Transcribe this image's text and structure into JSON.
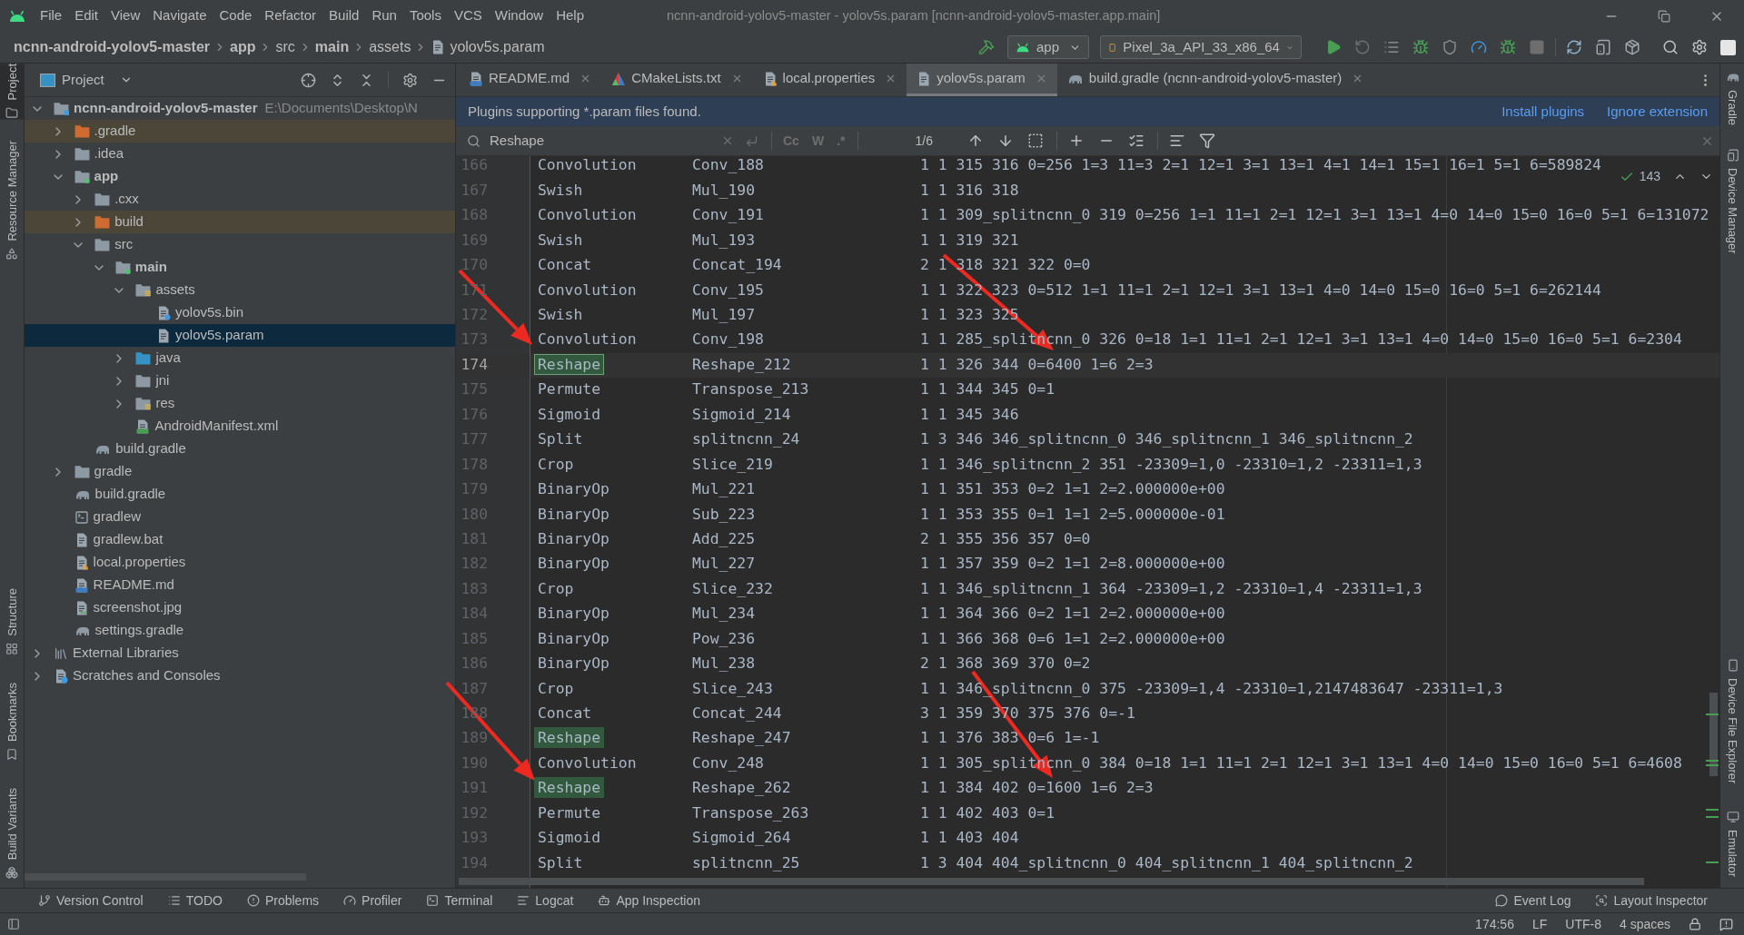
{
  "window": {
    "title": "ncnn-android-yolov5-master - yolov5s.param [ncnn-android-yolov5-master.app.main]"
  },
  "menu": [
    "File",
    "Edit",
    "View",
    "Navigate",
    "Code",
    "Refactor",
    "Build",
    "Run",
    "Tools",
    "VCS",
    "Window",
    "Help"
  ],
  "breadcrumbs": [
    {
      "label": "ncnn-android-yolov5-master",
      "kind": "module"
    },
    {
      "label": "app",
      "kind": "module"
    },
    {
      "label": "src",
      "kind": "folder"
    },
    {
      "label": "main",
      "kind": "module"
    },
    {
      "label": "assets",
      "kind": "folder"
    },
    {
      "label": "yolov5s.param",
      "kind": "file"
    }
  ],
  "toolbar": {
    "run_config": "app",
    "device": "Pixel_3a_API_33_x86_64"
  },
  "left_strip": {
    "top": [
      {
        "label": "Project",
        "kind": "project",
        "selected": true
      },
      {
        "label": "Resource Manager",
        "kind": "resources",
        "selected": false
      }
    ],
    "bottom": [
      {
        "label": "Structure",
        "kind": "structure",
        "selected": false
      },
      {
        "label": "Bookmarks",
        "kind": "bookmarks",
        "selected": false
      },
      {
        "label": "Build Variants",
        "kind": "variants",
        "selected": false
      }
    ]
  },
  "project": {
    "title": "Project",
    "tree": [
      {
        "label": "ncnn-android-yolov5-master",
        "path": "E:\\Documents\\Desktop\\N",
        "kind": "project",
        "expanded": true,
        "selected": false,
        "excluded": false,
        "children": [
          {
            "label": ".gradle",
            "kind": "folder",
            "expanded": false,
            "selected": false,
            "excluded": true
          },
          {
            "label": ".idea",
            "kind": "folder",
            "expanded": false,
            "selected": false,
            "excluded": false
          },
          {
            "label": "app",
            "kind": "module",
            "expanded": true,
            "selected": false,
            "excluded": false,
            "children": [
              {
                "label": ".cxx",
                "kind": "folder",
                "expanded": false,
                "selected": false,
                "excluded": false
              },
              {
                "label": "build",
                "kind": "folder",
                "expanded": false,
                "selected": false,
                "excluded": true
              },
              {
                "label": "src",
                "kind": "folder",
                "expanded": true,
                "selected": false,
                "excluded": false,
                "children": [
                  {
                    "label": "main",
                    "kind": "module",
                    "expanded": true,
                    "selected": false,
                    "excluded": false,
                    "children": [
                      {
                        "label": "assets",
                        "kind": "resources",
                        "expanded": true,
                        "selected": false,
                        "excluded": false,
                        "children": [
                          {
                            "label": "yolov5s.bin",
                            "kind": "binary",
                            "selected": false,
                            "excluded": false
                          },
                          {
                            "label": "yolov5s.param",
                            "kind": "text",
                            "selected": true,
                            "excluded": false
                          }
                        ]
                      },
                      {
                        "label": "java",
                        "kind": "source",
                        "expanded": false,
                        "selected": false,
                        "excluded": false
                      },
                      {
                        "label": "jni",
                        "kind": "folder",
                        "expanded": false,
                        "selected": false,
                        "excluded": false
                      },
                      {
                        "label": "res",
                        "kind": "resources",
                        "expanded": false,
                        "selected": false,
                        "excluded": false
                      },
                      {
                        "label": "AndroidManifest.xml",
                        "kind": "manifest",
                        "selected": false,
                        "excluded": false
                      }
                    ]
                  }
                ]
              },
              {
                "label": "build.gradle",
                "kind": "gradle",
                "selected": false,
                "excluded": false
              }
            ]
          },
          {
            "label": "gradle",
            "kind": "folder",
            "expanded": false,
            "selected": false,
            "excluded": false
          },
          {
            "label": "build.gradle",
            "kind": "gradle",
            "selected": false,
            "excluded": false
          },
          {
            "label": "gradlew",
            "kind": "script",
            "selected": false,
            "excluded": false
          },
          {
            "label": "gradlew.bat",
            "kind": "text",
            "selected": false,
            "excluded": false
          },
          {
            "label": "local.properties",
            "kind": "properties",
            "selected": false,
            "excluded": false
          },
          {
            "label": "README.md",
            "kind": "markdown",
            "selected": false,
            "excluded": false
          },
          {
            "label": "screenshot.jpg",
            "kind": "image",
            "selected": false,
            "excluded": false
          },
          {
            "label": "settings.gradle",
            "kind": "gradle",
            "selected": false,
            "excluded": false
          }
        ]
      },
      {
        "label": "External Libraries",
        "kind": "libraries",
        "expanded": false,
        "selected": false,
        "excluded": false
      },
      {
        "label": "Scratches and Consoles",
        "kind": "scratches",
        "expanded": false,
        "selected": false,
        "excluded": false
      }
    ]
  },
  "tabs": [
    {
      "label": "README.md",
      "kind": "markdown",
      "selected": false
    },
    {
      "label": "CMakeLists.txt",
      "kind": "cmake",
      "selected": false
    },
    {
      "label": "local.properties",
      "kind": "properties",
      "selected": false
    },
    {
      "label": "yolov5s.param",
      "kind": "text",
      "selected": true
    },
    {
      "label": "build.gradle (ncnn-android-yolov5-master)",
      "kind": "gradle",
      "selected": false
    }
  ],
  "notification": {
    "text": "Plugins supporting *.param files found.",
    "actions": [
      "Install plugins",
      "Ignore extension"
    ]
  },
  "search": {
    "value": "Reshape",
    "options": [
      "Cc",
      "W",
      ".*"
    ],
    "count": "1/6"
  },
  "inspection": {
    "count": "143"
  },
  "lines": [
    {
      "number": "166",
      "type": "Convolution",
      "name": "Conv_188",
      "params": "1 1 315 316 0=256 1=3 11=3 2=1 12=1 3=1 13=1 4=1 14=1 15=1 16=1 5=1 6=589824",
      "match": false,
      "current": false
    },
    {
      "number": "167",
      "type": "Swish",
      "name": "Mul_190",
      "params": "1 1 316 318",
      "match": false,
      "current": false
    },
    {
      "number": "168",
      "type": "Convolution",
      "name": "Conv_191",
      "params": "1 1 309_splitncnn_0 319 0=256 1=1 11=1 2=1 12=1 3=1 13=1 4=0 14=0 15=0 16=0 5=1 6=131072",
      "match": false,
      "current": false
    },
    {
      "number": "169",
      "type": "Swish",
      "name": "Mul_193",
      "params": "1 1 319 321",
      "match": false,
      "current": false
    },
    {
      "number": "170",
      "type": "Concat",
      "name": "Concat_194",
      "params": "2 1 318 321 322 0=0",
      "match": false,
      "current": false
    },
    {
      "number": "171",
      "type": "Convolution",
      "name": "Conv_195",
      "params": "1 1 322 323 0=512 1=1 11=1 2=1 12=1 3=1 13=1 4=0 14=0 15=0 16=0 5=1 6=262144",
      "match": false,
      "current": false
    },
    {
      "number": "172",
      "type": "Swish",
      "name": "Mul_197",
      "params": "1 1 323 325",
      "match": false,
      "current": false
    },
    {
      "number": "173",
      "type": "Convolution",
      "name": "Conv_198",
      "params": "1 1 285_splitncnn_0 326 0=18 1=1 11=1 2=1 12=1 3=1 13=1 4=0 14=0 15=0 16=0 5=1 6=2304",
      "match": false,
      "current": false
    },
    {
      "number": "174",
      "type": "Reshape",
      "name": "Reshape_212",
      "params": "1 1 326 344 0=6400 1=6 2=3",
      "match": true,
      "current": true
    },
    {
      "number": "175",
      "type": "Permute",
      "name": "Transpose_213",
      "params": "1 1 344 345 0=1",
      "match": false,
      "current": false
    },
    {
      "number": "176",
      "type": "Sigmoid",
      "name": "Sigmoid_214",
      "params": "1 1 345 346",
      "match": false,
      "current": false
    },
    {
      "number": "177",
      "type": "Split",
      "name": "splitncnn_24",
      "params": "1 3 346 346_splitncnn_0 346_splitncnn_1 346_splitncnn_2",
      "match": false,
      "current": false
    },
    {
      "number": "178",
      "type": "Crop",
      "name": "Slice_219",
      "params": "1 1 346_splitncnn_2 351 -23309=1,0 -23310=1,2 -23311=1,3",
      "match": false,
      "current": false
    },
    {
      "number": "179",
      "type": "BinaryOp",
      "name": "Mul_221",
      "params": "1 1 351 353 0=2 1=1 2=2.000000e+00",
      "match": false,
      "current": false
    },
    {
      "number": "180",
      "type": "BinaryOp",
      "name": "Sub_223",
      "params": "1 1 353 355 0=1 1=1 2=5.000000e-01",
      "match": false,
      "current": false
    },
    {
      "number": "181",
      "type": "BinaryOp",
      "name": "Add_225",
      "params": "2 1 355 356 357 0=0",
      "match": false,
      "current": false
    },
    {
      "number": "182",
      "type": "BinaryOp",
      "name": "Mul_227",
      "params": "1 1 357 359 0=2 1=1 2=8.000000e+00",
      "match": false,
      "current": false
    },
    {
      "number": "183",
      "type": "Crop",
      "name": "Slice_232",
      "params": "1 1 346_splitncnn_1 364 -23309=1,2 -23310=1,4 -23311=1,3",
      "match": false,
      "current": false
    },
    {
      "number": "184",
      "type": "BinaryOp",
      "name": "Mul_234",
      "params": "1 1 364 366 0=2 1=1 2=2.000000e+00",
      "match": false,
      "current": false
    },
    {
      "number": "185",
      "type": "BinaryOp",
      "name": "Pow_236",
      "params": "1 1 366 368 0=6 1=1 2=2.000000e+00",
      "match": false,
      "current": false
    },
    {
      "number": "186",
      "type": "BinaryOp",
      "name": "Mul_238",
      "params": "2 1 368 369 370 0=2",
      "match": false,
      "current": false
    },
    {
      "number": "187",
      "type": "Crop",
      "name": "Slice_243",
      "params": "1 1 346_splitncnn_0 375 -23309=1,4 -23310=1,2147483647 -23311=1,3",
      "match": false,
      "current": false
    },
    {
      "number": "188",
      "type": "Concat",
      "name": "Concat_244",
      "params": "3 1 359 370 375 376 0=-1",
      "match": false,
      "current": false
    },
    {
      "number": "189",
      "type": "Reshape",
      "name": "Reshape_247",
      "params": "1 1 376 383 0=6 1=-1",
      "match": true,
      "current": false
    },
    {
      "number": "190",
      "type": "Convolution",
      "name": "Conv_248",
      "params": "1 1 305_splitncnn_0 384 0=18 1=1 11=1 2=1 12=1 3=1 13=1 4=0 14=0 15=0 16=0 5=1 6=4608",
      "match": false,
      "current": false
    },
    {
      "number": "191",
      "type": "Reshape",
      "name": "Reshape_262",
      "params": "1 1 384 402 0=1600 1=6 2=3",
      "match": true,
      "current": false
    },
    {
      "number": "192",
      "type": "Permute",
      "name": "Transpose_263",
      "params": "1 1 402 403 0=1",
      "match": false,
      "current": false
    },
    {
      "number": "193",
      "type": "Sigmoid",
      "name": "Sigmoid_264",
      "params": "1 1 403 404",
      "match": false,
      "current": false
    },
    {
      "number": "194",
      "type": "Split",
      "name": "splitncnn_25",
      "params": "1 3 404 404_splitncnn_0 404_splitncnn_1 404_splitncnn_2",
      "match": false,
      "current": false
    }
  ],
  "right_strip": {
    "top": [
      {
        "label": "Gradle",
        "kind": "gradle"
      },
      {
        "label": "Device Manager",
        "kind": "devices"
      }
    ],
    "bottom": [
      {
        "label": "Device File Explorer",
        "kind": "files"
      },
      {
        "label": "Emulator",
        "kind": "emulator"
      }
    ]
  },
  "tool_windows": {
    "left": [
      {
        "label": "Version Control",
        "kind": "vcs"
      },
      {
        "label": "TODO",
        "kind": "todo"
      },
      {
        "label": "Problems",
        "kind": "problems"
      },
      {
        "label": "Profiler",
        "kind": "profiler"
      },
      {
        "label": "Terminal",
        "kind": "terminal"
      },
      {
        "label": "Logcat",
        "kind": "logcat"
      },
      {
        "label": "App Inspection",
        "kind": "inspection"
      }
    ],
    "right": [
      {
        "label": "Event Log",
        "kind": "events"
      },
      {
        "label": "Layout Inspector",
        "kind": "layout"
      }
    ]
  },
  "status_bar": {
    "position": "174:56",
    "line_separator": "LF",
    "encoding": "UTF-8",
    "indent": "4 spaces"
  }
}
